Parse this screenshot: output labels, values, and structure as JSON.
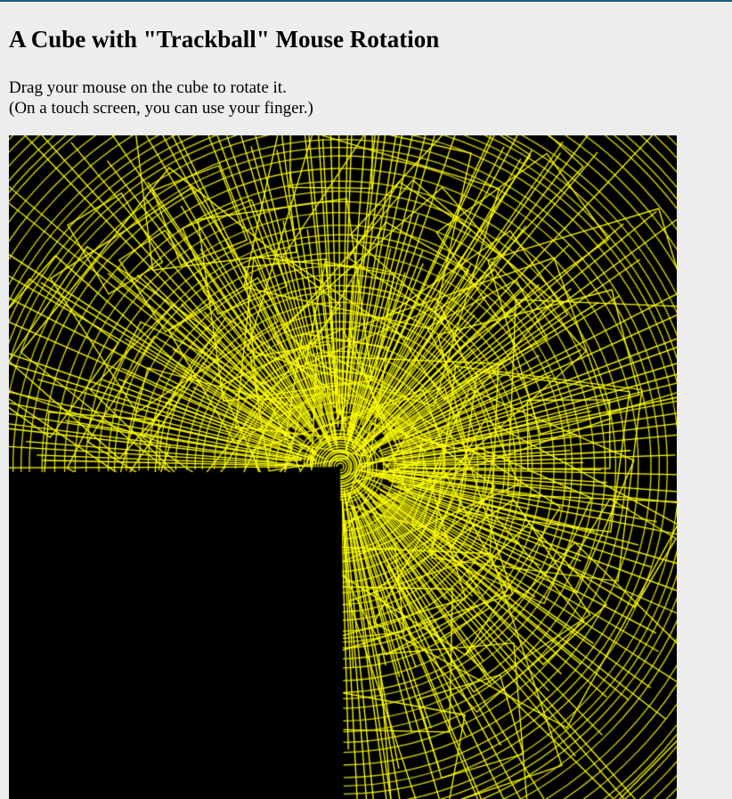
{
  "page": {
    "title": "A Cube with \"Trackball\" Mouse Rotation",
    "instruction_line1": "Drag your mouse on the cube to rotate it.",
    "instruction_line2": "(On a touch screen, you can use your finger.)"
  },
  "canvas": {
    "background_color": "#000000",
    "stroke_color": "#ffff00",
    "accent_border_color": "#1a5b7a"
  }
}
